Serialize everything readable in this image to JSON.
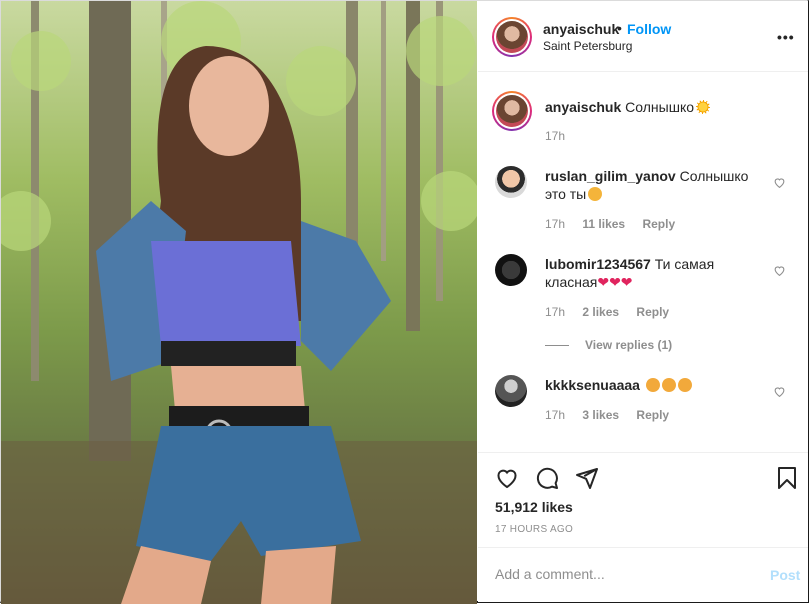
{
  "header": {
    "username": "anyaischuk",
    "separator": "•",
    "follow_label": "Follow",
    "location": "Saint Petersburg",
    "more_label": "•••"
  },
  "caption": {
    "username": "anyaischuk",
    "text": "Солнышко",
    "emoji": "sun-emoji",
    "time": "17h"
  },
  "comments": [
    {
      "username": "ruslan_gilim_yanov",
      "text": "Солнышко это ты",
      "emoji": "heart-eyes-emoji",
      "time": "17h",
      "likes": "11 likes",
      "reply": "Reply"
    },
    {
      "username": "lubomir1234567",
      "text": "Ти самая класная",
      "emoji": "red-hearts",
      "hearts": "❤❤❤",
      "time": "17h",
      "likes": "2 likes",
      "reply": "Reply",
      "view_replies": "View replies (1)"
    },
    {
      "username": "kkkksenuaaaa",
      "text": "",
      "emoji": "sad-faces",
      "time": "17h",
      "likes": "3 likes",
      "reply": "Reply"
    }
  ],
  "actions": {
    "like_icon": "heart-icon",
    "comment_icon": "comment-icon",
    "share_icon": "share-icon",
    "save_icon": "bookmark-icon",
    "likes_total": "51,912 likes",
    "time_ago": "17 HOURS AGO"
  },
  "add_comment": {
    "placeholder": "Add a comment...",
    "post_label": "Post"
  },
  "colors": {
    "accent": "#0095f6",
    "post_disabled": "#b2dffc",
    "muted": "#8e8e8e",
    "text": "#262626"
  }
}
